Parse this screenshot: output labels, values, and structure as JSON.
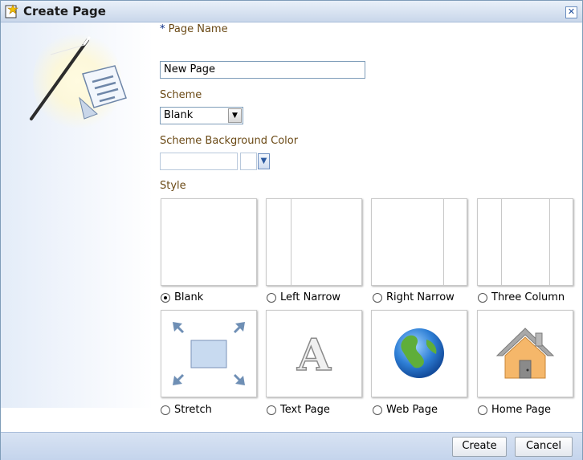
{
  "dialog": {
    "title": "Create Page",
    "close_glyph": "✕"
  },
  "form": {
    "page_name": {
      "required_mark": "*",
      "label": "Page Name",
      "value": "New Page"
    },
    "scheme": {
      "label": "Scheme",
      "selected": "Blank"
    },
    "scheme_background": {
      "label": "Scheme Background Color",
      "value": ""
    },
    "style": {
      "label": "Style",
      "options": [
        {
          "label": "Blank",
          "selected": true,
          "icon": "blank-layout"
        },
        {
          "label": "Left Narrow",
          "selected": false,
          "icon": "left-narrow-layout"
        },
        {
          "label": "Right Narrow",
          "selected": false,
          "icon": "right-narrow-layout"
        },
        {
          "label": "Three Column",
          "selected": false,
          "icon": "three-column-layout"
        },
        {
          "label": "Stretch",
          "selected": false,
          "icon": "stretch-icon"
        },
        {
          "label": "Text Page",
          "selected": false,
          "icon": "text-page-icon"
        },
        {
          "label": "Web Page",
          "selected": false,
          "icon": "globe-icon"
        },
        {
          "label": "Home Page",
          "selected": false,
          "icon": "home-icon"
        }
      ]
    }
  },
  "footer": {
    "create_label": "Create",
    "cancel_label": "Cancel"
  },
  "colors": {
    "title_bar": "#c9d7ea",
    "label_text": "#6b4a16",
    "border": "#7f9db9"
  }
}
